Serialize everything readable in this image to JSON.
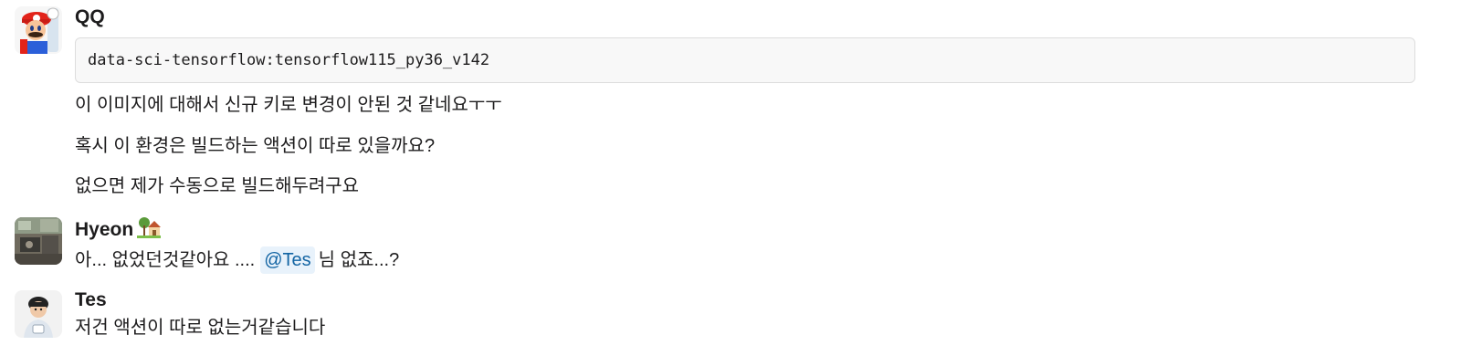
{
  "messages": [
    {
      "author": "QQ",
      "code": "data-sci-tensorflow:tensorflow115_py36_v142",
      "lines": [
        "이 이미지에 대해서 신규 키로 변경이 안된 것 같네요ㅜㅜ",
        "혹시 이 환경은 빌드하는 액션이 따로 있을까요?",
        "없으면 제가 수동으로 빌드해두려구요"
      ]
    },
    {
      "author": "Hyeon",
      "author_emoji": "house-with-garden-emoji",
      "text_before": "아... 없었던것같아요 ....",
      "mention": "@Tes",
      "text_after": "님 없죠...?"
    },
    {
      "author": "Tes",
      "text": "저건 액션이 따로 없는거같습니다"
    }
  ],
  "colors": {
    "mention_bg": "#e8f2fb",
    "mention_text": "#1264a3",
    "code_bg": "#f8f8f8",
    "code_border": "#dddddd"
  }
}
